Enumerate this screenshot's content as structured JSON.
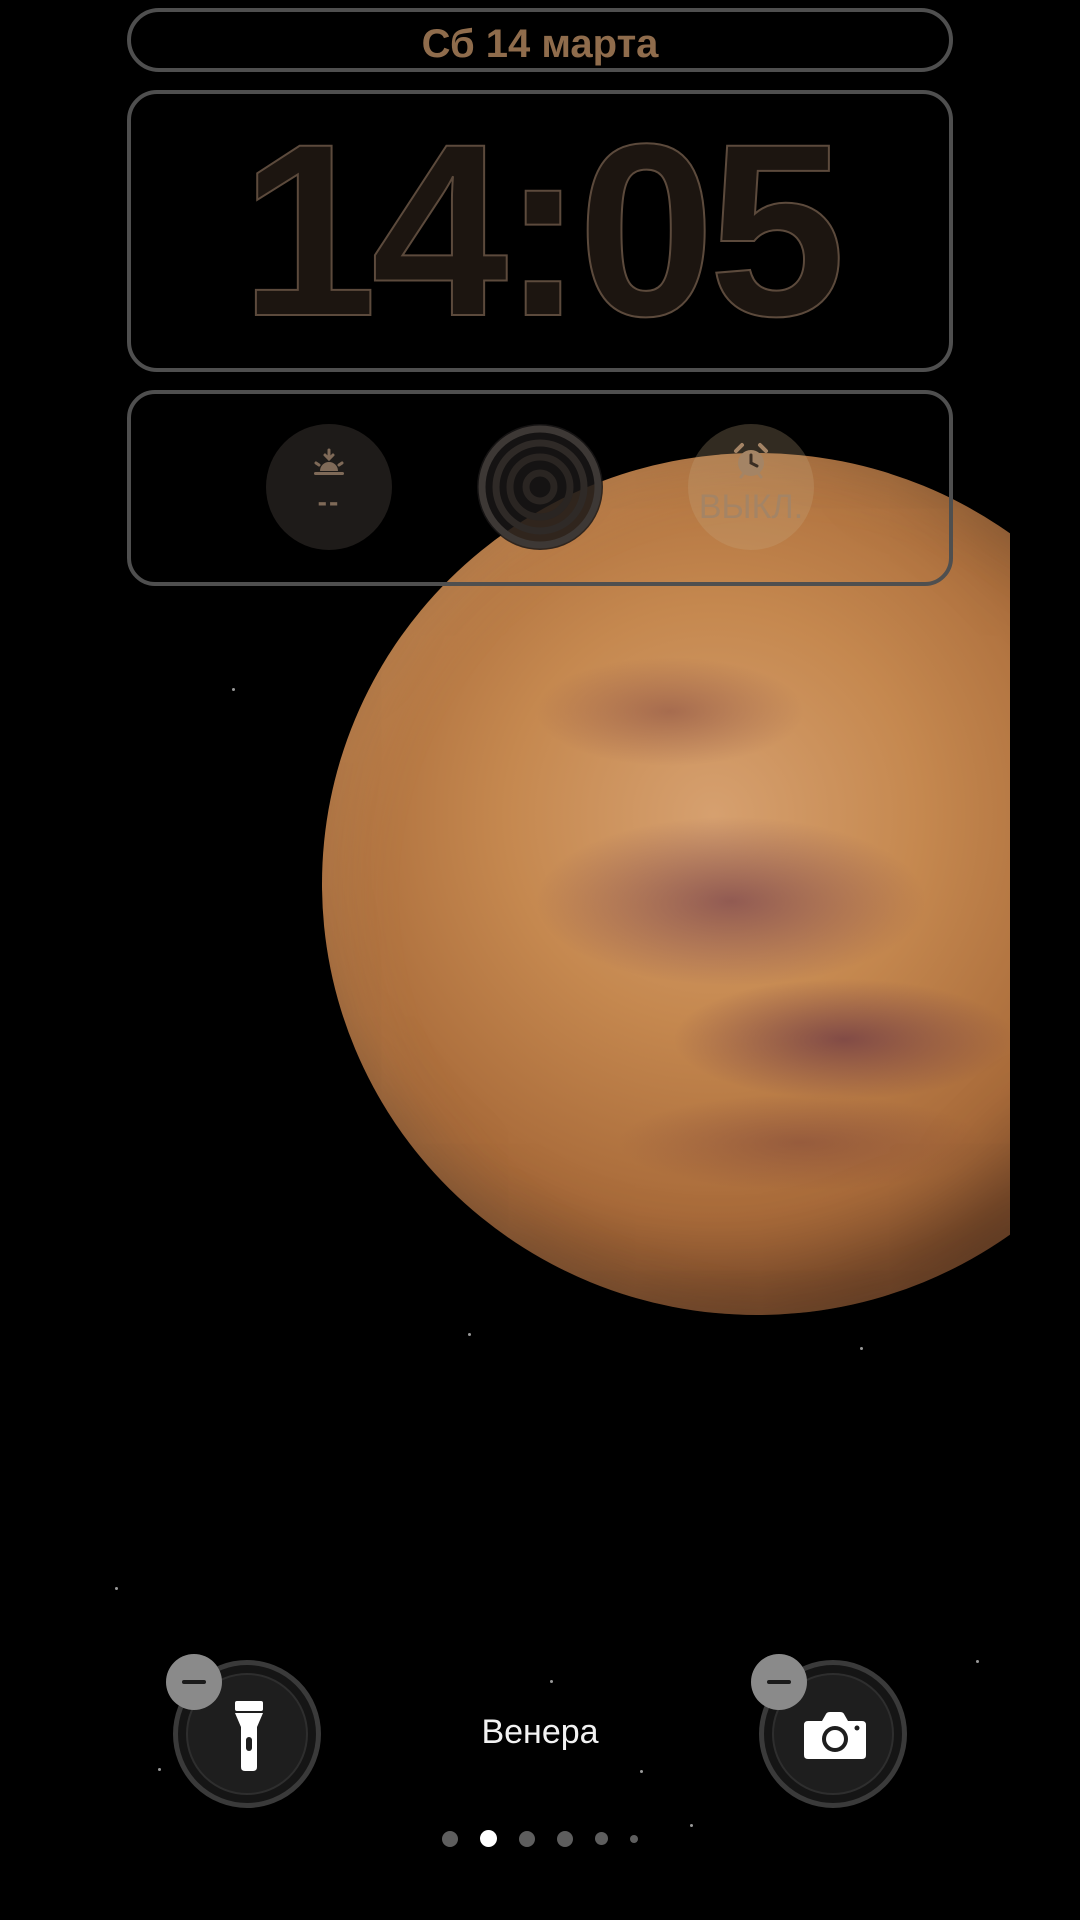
{
  "lock_screen": {
    "date": "Сб 14 марта",
    "time": "14:05",
    "widgets": {
      "sunrise": {
        "icon": "sunrise-icon",
        "value": "--"
      },
      "focus": {
        "icon": "focus-rings-icon"
      },
      "alarm": {
        "icon": "alarm-clock-icon",
        "value": "ВЫКЛ."
      }
    },
    "wallpaper_name": "Венера",
    "quick_actions": {
      "left": {
        "icon": "flashlight-icon",
        "badge_icon": "minus-icon"
      },
      "right": {
        "icon": "camera-icon",
        "badge_icon": "minus-icon"
      }
    },
    "pages": {
      "count": 6,
      "active_index": 1
    }
  },
  "colors": {
    "background": "#000000",
    "widget_text": "#8f6c4c",
    "frame": "#4f4f4f",
    "planet": "#c5884f"
  }
}
